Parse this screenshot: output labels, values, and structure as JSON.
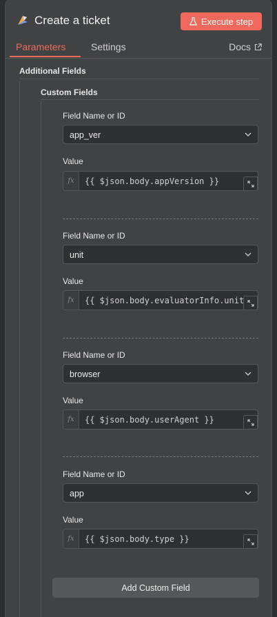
{
  "header": {
    "title": "Create a ticket",
    "execute_label": "Execute step"
  },
  "tabs": [
    {
      "label": "Parameters",
      "active": true
    },
    {
      "label": "Settings",
      "active": false
    }
  ],
  "docs_label": "Docs",
  "sections": {
    "additional_fields": "Additional Fields",
    "custom_fields": "Custom Fields"
  },
  "custom_fields": [
    {
      "name_label": "Field Name or ID",
      "name_value": "app_ver",
      "value_label": "Value",
      "value_expr": "{{ $json.body.appVersion }}"
    },
    {
      "name_label": "Field Name or ID",
      "name_value": "unit",
      "value_label": "Value",
      "value_expr": "{{ $json.body.evaluatorInfo.unit"
    },
    {
      "name_label": "Field Name or ID",
      "name_value": "browser",
      "value_label": "Value",
      "value_expr": "{{ $json.body.userAgent }}"
    },
    {
      "name_label": "Field Name or ID",
      "name_value": "app",
      "value_label": "Value",
      "value_expr": "{{ $json.body.type }}"
    }
  ],
  "fx_label": "fx",
  "add_button_label": "Add Custom Field",
  "colors": {
    "accent": "#ef6a5c",
    "panel": "#414244",
    "background": "#2b2d31"
  }
}
